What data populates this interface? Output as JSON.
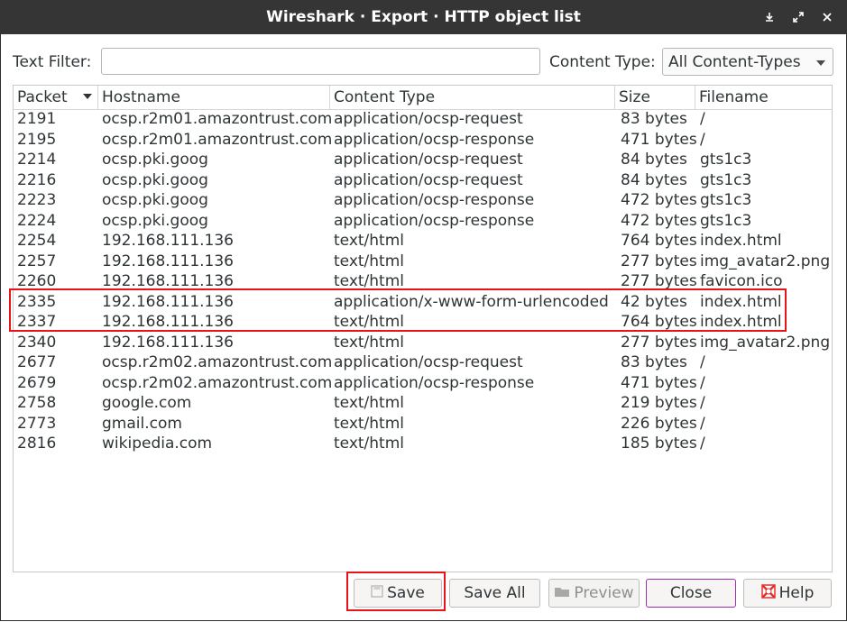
{
  "window": {
    "title": "Wireshark · Export · HTTP object list"
  },
  "filter": {
    "label": "Text Filter:",
    "value": "",
    "placeholder": ""
  },
  "content_type": {
    "label": "Content Type:",
    "selected": "All Content-Types"
  },
  "table": {
    "columns": [
      "Packet",
      "Hostname",
      "Content Type",
      "Size",
      "Filename"
    ],
    "rows": [
      {
        "packet": "2191",
        "hostname": "ocsp.r2m01.amazontrust.com",
        "content_type": "application/ocsp-request",
        "size": "83 bytes",
        "filename": "/"
      },
      {
        "packet": "2195",
        "hostname": "ocsp.r2m01.amazontrust.com",
        "content_type": "application/ocsp-response",
        "size": "471 bytes",
        "filename": "/"
      },
      {
        "packet": "2214",
        "hostname": "ocsp.pki.goog",
        "content_type": "application/ocsp-request",
        "size": "84 bytes",
        "filename": "gts1c3"
      },
      {
        "packet": "2216",
        "hostname": "ocsp.pki.goog",
        "content_type": "application/ocsp-request",
        "size": "84 bytes",
        "filename": "gts1c3"
      },
      {
        "packet": "2223",
        "hostname": "ocsp.pki.goog",
        "content_type": "application/ocsp-response",
        "size": "472 bytes",
        "filename": "gts1c3"
      },
      {
        "packet": "2224",
        "hostname": "ocsp.pki.goog",
        "content_type": "application/ocsp-response",
        "size": "472 bytes",
        "filename": "gts1c3"
      },
      {
        "packet": "2254",
        "hostname": "192.168.111.136",
        "content_type": "text/html",
        "size": "764 bytes",
        "filename": "index.html"
      },
      {
        "packet": "2257",
        "hostname": "192.168.111.136",
        "content_type": "text/html",
        "size": "277 bytes",
        "filename": "img_avatar2.png"
      },
      {
        "packet": "2260",
        "hostname": "192.168.111.136",
        "content_type": "text/html",
        "size": "277 bytes",
        "filename": "favicon.ico"
      },
      {
        "packet": "2335",
        "hostname": "192.168.111.136",
        "content_type": "application/x-www-form-urlencoded",
        "size": "42 bytes",
        "filename": "index.html"
      },
      {
        "packet": "2337",
        "hostname": "192.168.111.136",
        "content_type": "text/html",
        "size": "764 bytes",
        "filename": "index.html"
      },
      {
        "packet": "2340",
        "hostname": "192.168.111.136",
        "content_type": "text/html",
        "size": "277 bytes",
        "filename": "img_avatar2.png"
      },
      {
        "packet": "2677",
        "hostname": "ocsp.r2m02.amazontrust.com",
        "content_type": "application/ocsp-request",
        "size": "83 bytes",
        "filename": "/"
      },
      {
        "packet": "2679",
        "hostname": "ocsp.r2m02.amazontrust.com",
        "content_type": "application/ocsp-response",
        "size": "471 bytes",
        "filename": "/"
      },
      {
        "packet": "2758",
        "hostname": "google.com",
        "content_type": "text/html",
        "size": "219 bytes",
        "filename": "/"
      },
      {
        "packet": "2773",
        "hostname": "gmail.com",
        "content_type": "text/html",
        "size": "226 bytes",
        "filename": "/"
      },
      {
        "packet": "2816",
        "hostname": "wikipedia.com",
        "content_type": "text/html",
        "size": "185 bytes",
        "filename": "/"
      }
    ]
  },
  "buttons": {
    "save": "Save",
    "save_all": "Save All",
    "preview": "Preview",
    "close": "Close",
    "help": "Help"
  },
  "colors": {
    "titlebar": "#353535",
    "highlight": "#e8141a",
    "close_border": "#9b2fae"
  }
}
